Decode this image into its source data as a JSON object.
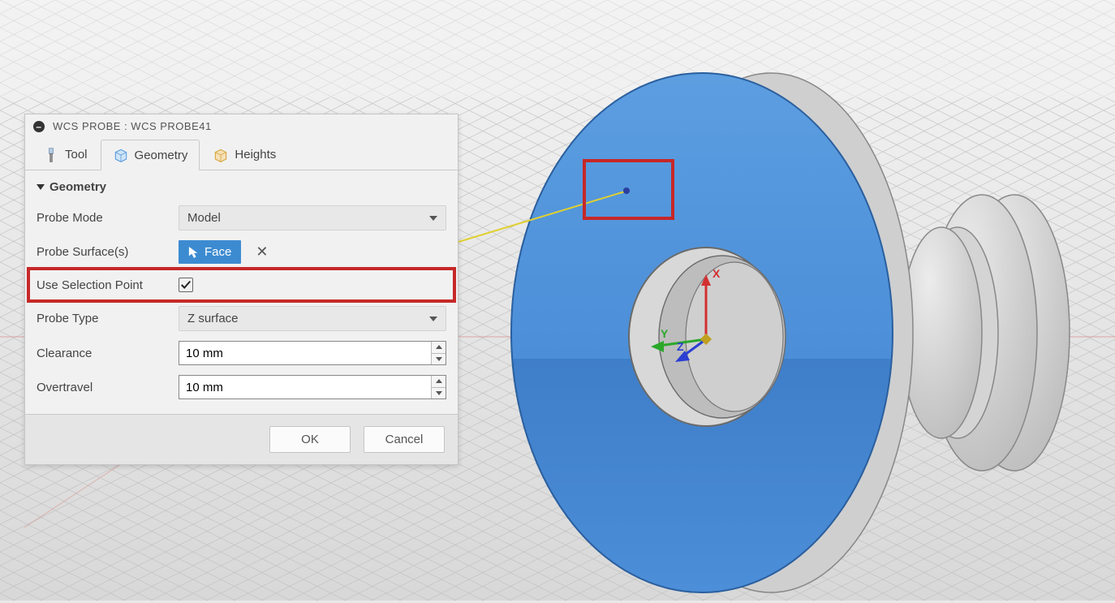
{
  "panel": {
    "title_prefix": "WCS PROBE : ",
    "title_name": "WCS PROBE41"
  },
  "tabs": {
    "tool": "Tool",
    "geometry": "Geometry",
    "heights": "Heights"
  },
  "section": {
    "geometry_header": "Geometry"
  },
  "fields": {
    "probe_mode_label": "Probe Mode",
    "probe_mode_value": "Model",
    "probe_surfaces_label": "Probe Surface(s)",
    "probe_surfaces_chip": "Face",
    "use_selection_point_label": "Use Selection Point",
    "use_selection_point_checked": true,
    "probe_type_label": "Probe Type",
    "probe_type_value": "Z surface",
    "clearance_label": "Clearance",
    "clearance_value": "10 mm",
    "overtravel_label": "Overtravel",
    "overtravel_value": "10 mm"
  },
  "buttons": {
    "ok": "OK",
    "cancel": "Cancel"
  },
  "axes": {
    "x": "X",
    "y": "Y",
    "z": "Z"
  },
  "colors": {
    "accent": "#3c8bd1",
    "highlight": "#c62828",
    "face_select": "#4c8ed8"
  }
}
